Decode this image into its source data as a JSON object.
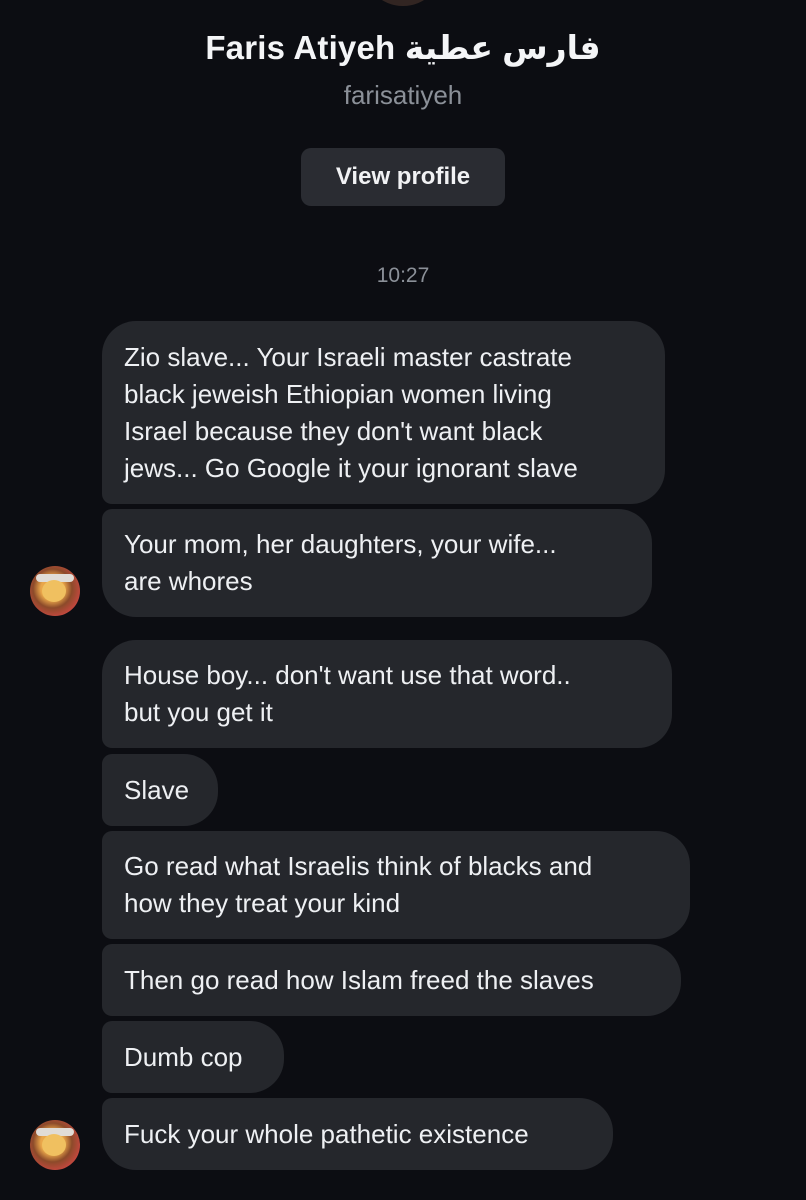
{
  "header": {
    "name": "Faris Atiyeh فارس عطية",
    "handle": "farisatiyeh",
    "view_profile_label": "View profile"
  },
  "timestamp": "10:27",
  "messages": [
    {
      "text": "Zio slave... Your Israeli master castrate\nblack jeweish Ethiopian women living\nIsrael because they don't want black\njews... Go Google it your ignorant slave"
    },
    {
      "text": "Your mom, her daughters, your wife...\nare whores"
    },
    {
      "text": "House boy... don't want use that word..\nbut you get it"
    },
    {
      "text": "Slave"
    },
    {
      "text": "Go read what Israelis think of blacks and\nhow they treat your kind"
    },
    {
      "text": "Then go read how Islam freed the slaves"
    },
    {
      "text": "Dumb cop"
    },
    {
      "text": "Fuck your whole pathetic existence"
    }
  ],
  "colors": {
    "background": "#0c0d12",
    "bubble": "#25272c",
    "secondary_text": "#8b9098",
    "button": "#2a2c32"
  }
}
